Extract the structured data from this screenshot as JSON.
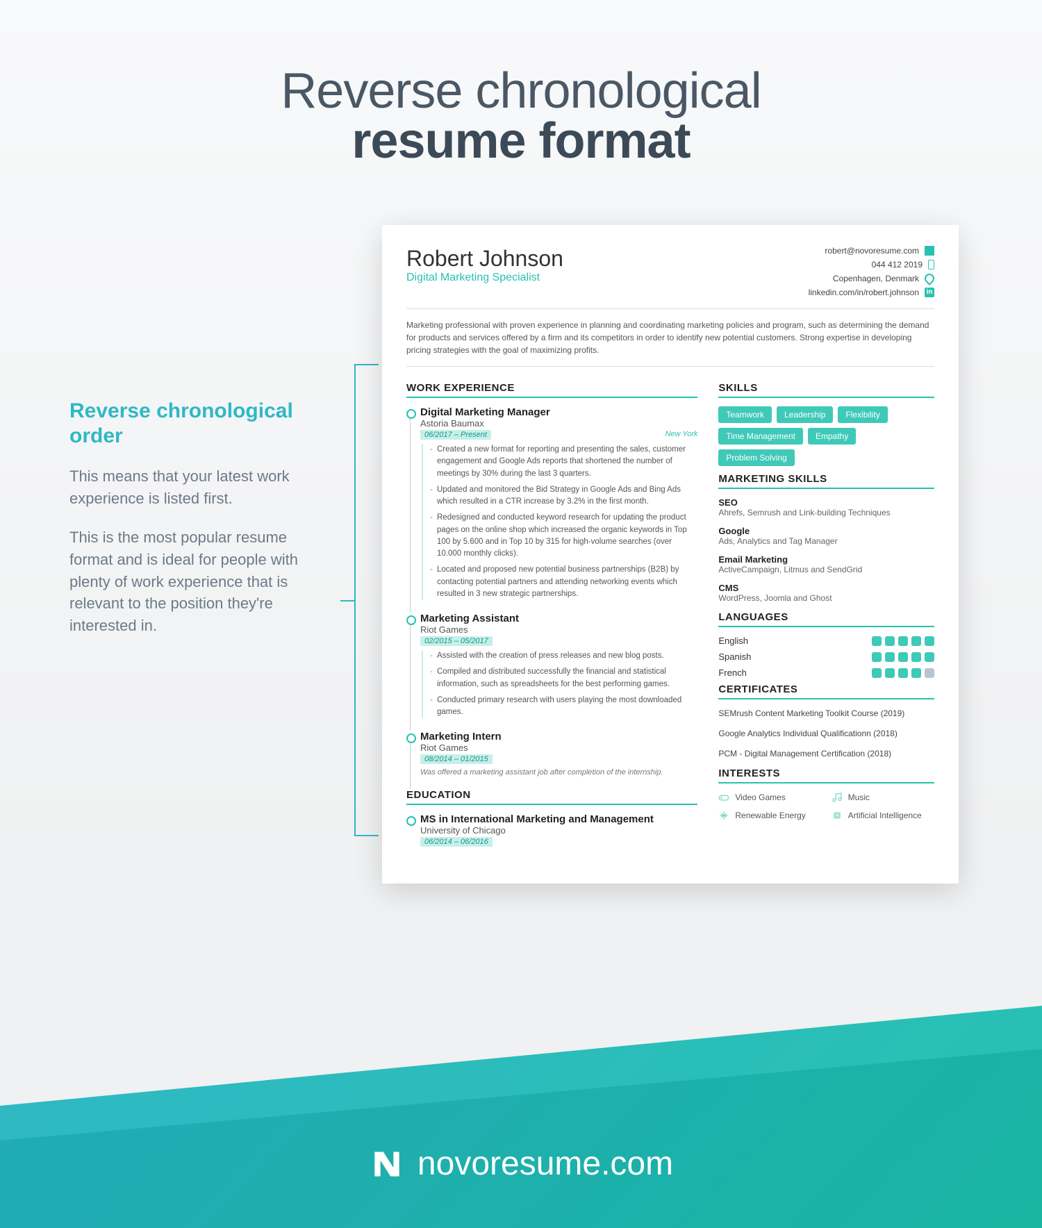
{
  "header": {
    "line1": "Reverse chronological",
    "line2": "resume format"
  },
  "sidebar": {
    "title": "Reverse chronological order",
    "para1": "This means that your latest work experience is listed first.",
    "para2": "This is the most popular resume format and is ideal for people with plenty of work experience that is relevant to the position they're interested in."
  },
  "resume": {
    "name": "Robert Johnson",
    "role": "Digital Marketing Specialist",
    "contact": {
      "email": "robert@novoresume.com",
      "phone": "044 412 2019",
      "location": "Copenhagen, Denmark",
      "linkedin": "linkedin.com/in/robert.johnson"
    },
    "summary": "Marketing professional with proven experience in planning and coordinating marketing policies and program, such as determining the demand for products and services offered by a firm and its competitors in order to identify new potential customers. Strong expertise in developing pricing strategies with the goal of maximizing profits.",
    "sections": {
      "work": "WORK EXPERIENCE",
      "edu": "EDUCATION",
      "skills": "SKILLS",
      "mkt": "MARKETING SKILLS",
      "lang": "LANGUAGES",
      "cert": "CERTIFICATES",
      "int": "INTERESTS"
    },
    "jobs": [
      {
        "title": "Digital Marketing Manager",
        "company": "Astoria Baumax",
        "dates": "06/2017 – Present",
        "location": "New York",
        "bullets": [
          "Created a new format for reporting and presenting the sales, customer engagement and Google Ads reports that shortened the number of meetings by 30% during the last 3 quarters.",
          "Updated and monitored the Bid Strategy in Google Ads and Bing Ads which resulted in a CTR increase by 3.2% in the first month.",
          "Redesigned and conducted keyword research for updating the product pages on the online shop which increased the organic keywords in Top 100 by 5.600 and in Top 10 by 315 for high-volume searches (over 10.000 monthly clicks).",
          "Located and proposed new potential business partnerships (B2B) by contacting potential partners and attending networking events which resulted in 3 new strategic partnerships."
        ]
      },
      {
        "title": "Marketing Assistant",
        "company": "Riot Games",
        "dates": "02/2015 – 05/2017",
        "bullets": [
          "Assisted with the creation of press releases and new blog posts.",
          "Compiled and distributed successfully the financial and statistical information, such as spreadsheets for the best performing games.",
          "Conducted primary research with users playing the most downloaded games."
        ]
      },
      {
        "title": "Marketing Intern",
        "company": "Riot Games",
        "dates": "08/2014 – 01/2015",
        "note": "Was offered a marketing assistant job after completion of the internship."
      }
    ],
    "education": {
      "degree": "MS in International Marketing and Management",
      "school": "University of Chicago",
      "dates": "06/2014 – 06/2016"
    },
    "skill_tags": [
      "Teamwork",
      "Leadership",
      "Flexibility",
      "Time Management",
      "Empathy",
      "Problem Solving"
    ],
    "mkt_skills": [
      {
        "name": "SEO",
        "desc": "Ahrefs, Semrush and Link-building Techniques"
      },
      {
        "name": "Google",
        "desc": "Ads, Analytics and Tag Manager"
      },
      {
        "name": "Email Marketing",
        "desc": "ActiveCampaign, Litmus and SendGrid"
      },
      {
        "name": "CMS",
        "desc": "WordPress, Joomla and Ghost"
      }
    ],
    "languages": [
      {
        "name": "English",
        "level": 5
      },
      {
        "name": "Spanish",
        "level": 5
      },
      {
        "name": "French",
        "level": 4
      }
    ],
    "certificates": [
      "SEMrush Content Marketing Toolkit Course (2019)",
      "Google Analytics Individual Qualificationn (2018)",
      "PCM - Digital Management Certification (2018)"
    ],
    "interests": [
      "Video Games",
      "Music",
      "Renewable Energy",
      "Artificial Intelligence"
    ]
  },
  "footer": {
    "brand": "novoresume.com"
  }
}
